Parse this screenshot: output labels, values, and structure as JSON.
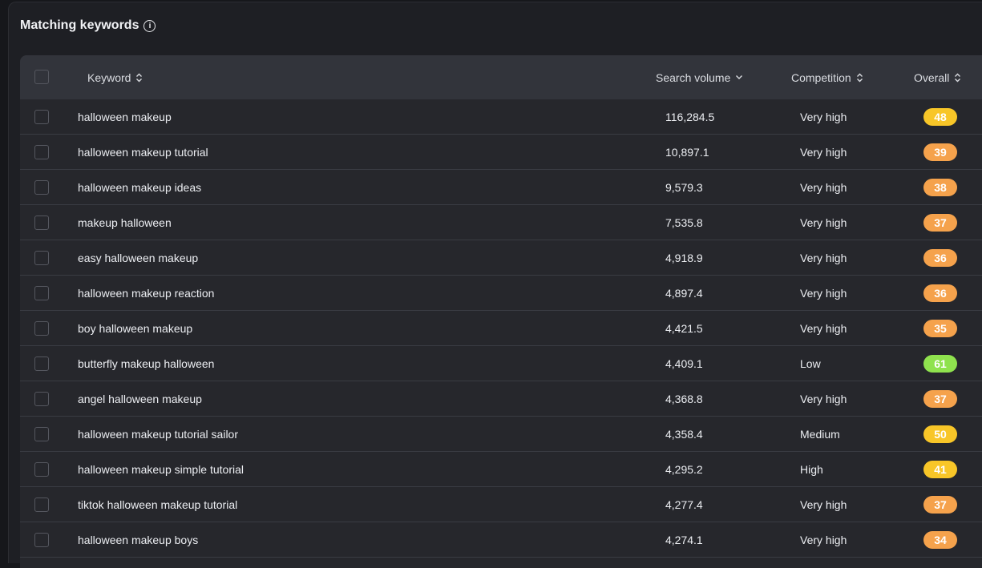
{
  "section": {
    "title": "Matching keywords",
    "info_icon": "info-icon"
  },
  "table": {
    "columns": {
      "keyword": "Keyword",
      "search_volume": "Search volume",
      "competition": "Competition",
      "overall": "Overall"
    },
    "colors": {
      "orange": "#f5a24c",
      "yellow": "#f8c628",
      "green": "#8fe24e"
    },
    "rows": [
      {
        "keyword": "halloween makeup",
        "volume": "116,284.5",
        "competition": "Very high",
        "overall": "48",
        "color": "#f8c628"
      },
      {
        "keyword": "halloween makeup tutorial",
        "volume": "10,897.1",
        "competition": "Very high",
        "overall": "39",
        "color": "#f5a24c"
      },
      {
        "keyword": "halloween makeup ideas",
        "volume": "9,579.3",
        "competition": "Very high",
        "overall": "38",
        "color": "#f5a24c"
      },
      {
        "keyword": "makeup halloween",
        "volume": "7,535.8",
        "competition": "Very high",
        "overall": "37",
        "color": "#f5a24c"
      },
      {
        "keyword": "easy halloween makeup",
        "volume": "4,918.9",
        "competition": "Very high",
        "overall": "36",
        "color": "#f5a24c"
      },
      {
        "keyword": "halloween makeup reaction",
        "volume": "4,897.4",
        "competition": "Very high",
        "overall": "36",
        "color": "#f5a24c"
      },
      {
        "keyword": "boy halloween makeup",
        "volume": "4,421.5",
        "competition": "Very high",
        "overall": "35",
        "color": "#f5a24c"
      },
      {
        "keyword": "butterfly makeup halloween",
        "volume": "4,409.1",
        "competition": "Low",
        "overall": "61",
        "color": "#8fe24e"
      },
      {
        "keyword": "angel halloween makeup",
        "volume": "4,368.8",
        "competition": "Very high",
        "overall": "37",
        "color": "#f5a24c"
      },
      {
        "keyword": "halloween makeup tutorial sailor",
        "volume": "4,358.4",
        "competition": "Medium",
        "overall": "50",
        "color": "#f8c628"
      },
      {
        "keyword": "halloween makeup simple tutorial",
        "volume": "4,295.2",
        "competition": "High",
        "overall": "41",
        "color": "#f8c628"
      },
      {
        "keyword": "tiktok halloween makeup tutorial",
        "volume": "4,277.4",
        "competition": "Very high",
        "overall": "37",
        "color": "#f5a24c"
      },
      {
        "keyword": "halloween makeup boys",
        "volume": "4,274.1",
        "competition": "Very high",
        "overall": "34",
        "color": "#f5a24c"
      }
    ]
  }
}
